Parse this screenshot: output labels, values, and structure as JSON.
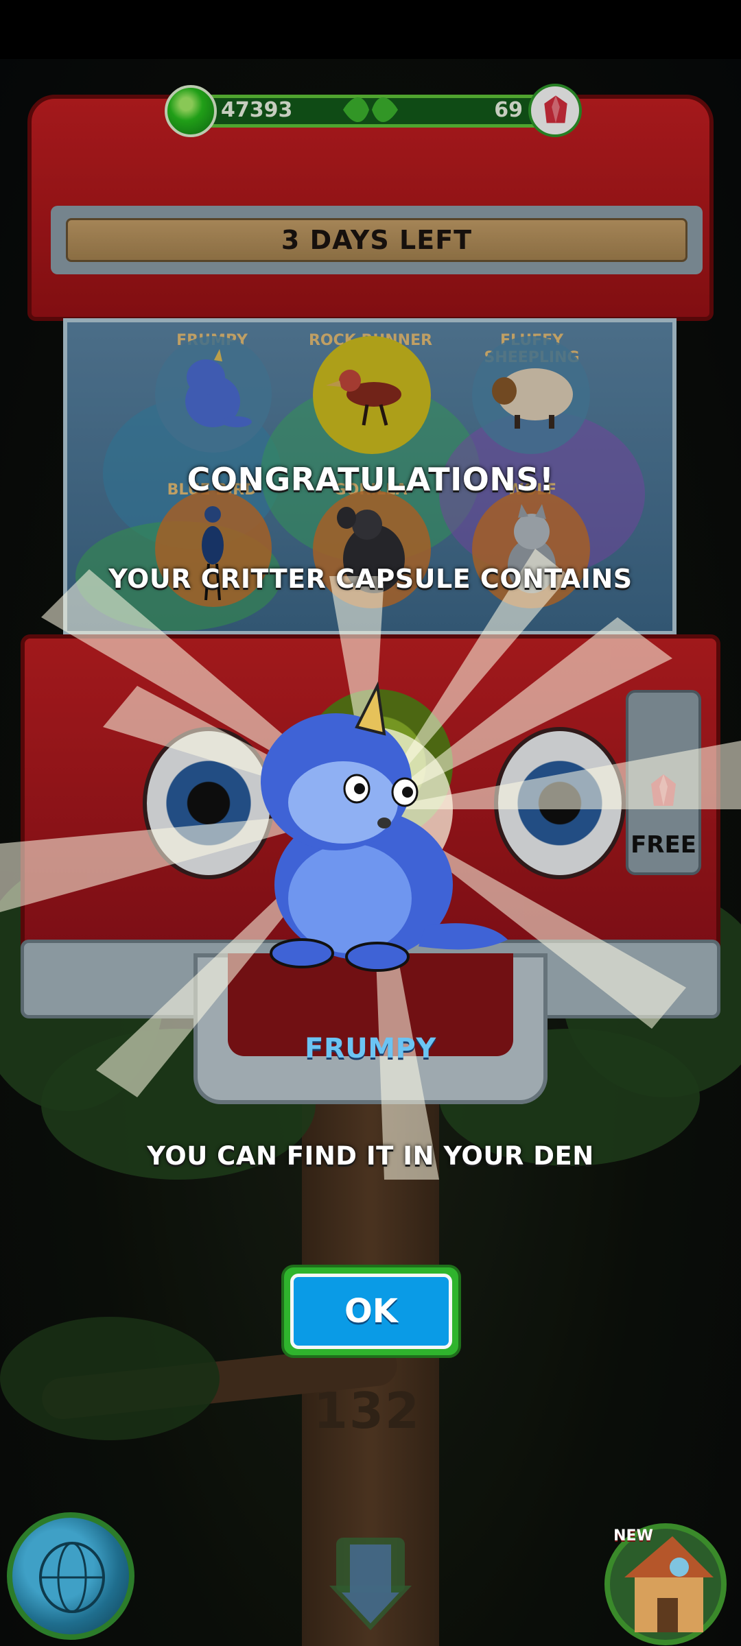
{
  "hud": {
    "coins": "47393",
    "gems": "69"
  },
  "machine": {
    "banner": "3 DAYS LEFT",
    "free_label": "FREE",
    "level_number": "132",
    "prizes": [
      {
        "name": "FRUMPY",
        "ring_color": "#4f86a9"
      },
      {
        "name": "ROCK RUNNER",
        "ring_color": "#d4c21f"
      },
      {
        "name": "FLUFFY SHEEPLING",
        "ring_color": "#4f86a9"
      },
      {
        "name": "BLUE BIRD",
        "ring_color": "#c8742f"
      },
      {
        "name": "GORILLA",
        "ring_color": "#c8742f"
      },
      {
        "name": "WOLF",
        "ring_color": "#c8742f"
      }
    ]
  },
  "dialog": {
    "congrats": "CONGRATULATIONS!",
    "contains": "YOUR CRITTER CAPSULE CONTAINS",
    "critter_name": "FRUMPY",
    "find_text": "YOU CAN FIND IT IN YOUR DEN",
    "ok_label": "OK"
  },
  "bottom_nav": {
    "new_badge": "NEW"
  },
  "colors": {
    "critter_blue": "#3f63d6",
    "ok_blue": "#0a9be6",
    "machine_red": "#c41f22"
  }
}
